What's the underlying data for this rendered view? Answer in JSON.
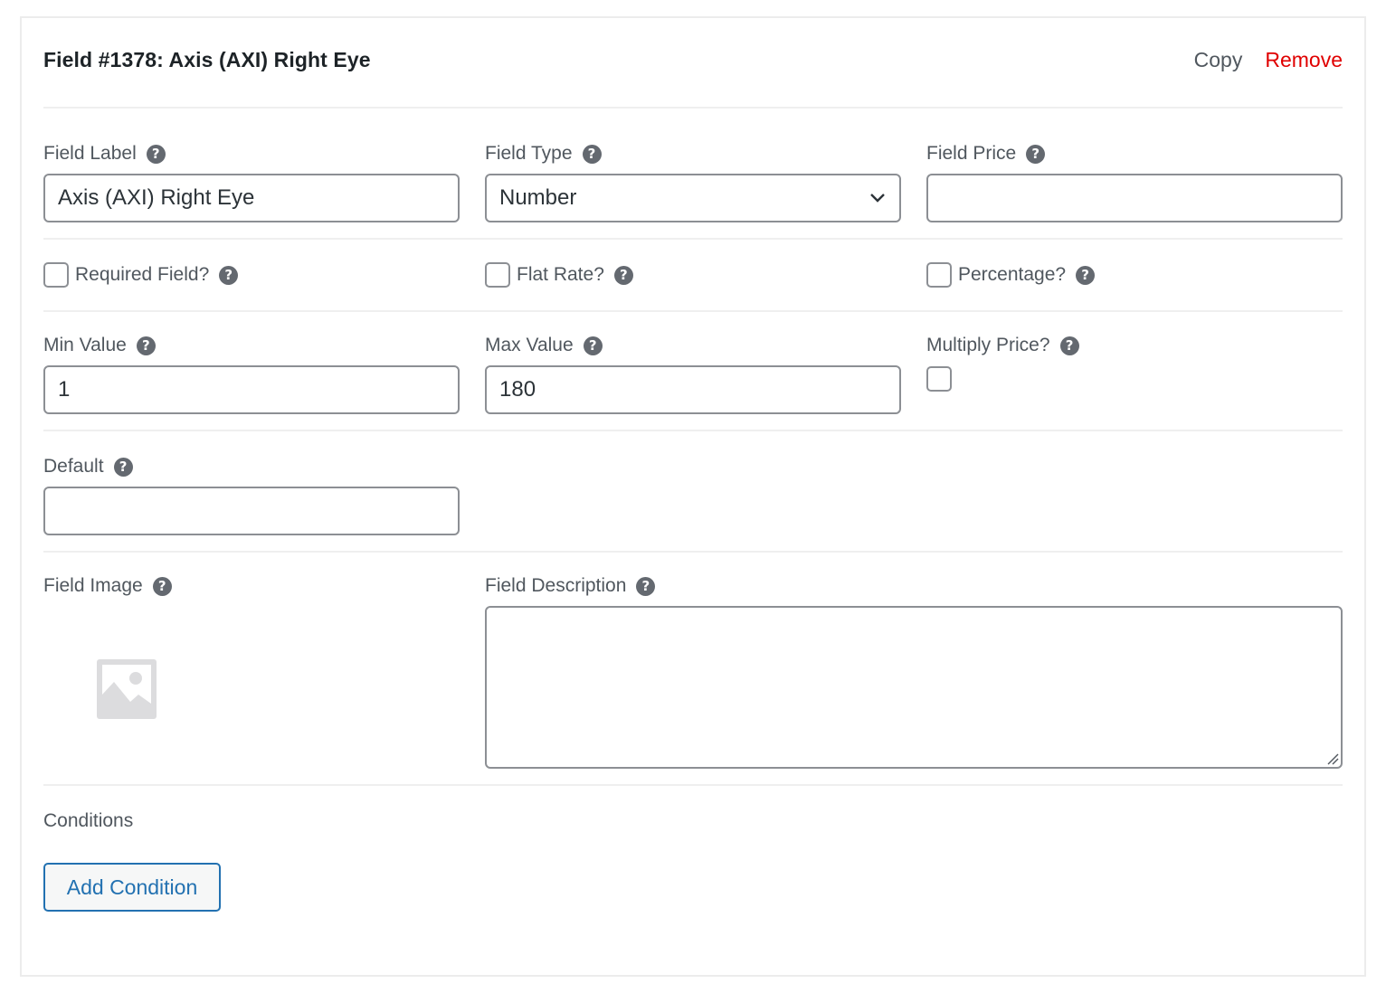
{
  "header": {
    "title": "Field #1378: Axis (AXI) Right Eye",
    "copy_label": "Copy",
    "remove_label": "Remove"
  },
  "colors": {
    "remove": "#e00000",
    "accent": "#2271b1",
    "help_icon": "#646970"
  },
  "fields": {
    "field_label": {
      "label": "Field Label",
      "value": "Axis (AXI) Right Eye",
      "help_icon": "question-circle-icon"
    },
    "field_type": {
      "label": "Field Type",
      "value": "Number",
      "help_icon": "question-circle-icon"
    },
    "field_price": {
      "label": "Field Price",
      "value": "",
      "help_icon": "question-circle-icon"
    },
    "required_field": {
      "label": "Required Field?",
      "checked": false
    },
    "flat_rate": {
      "label": "Flat Rate?",
      "checked": false
    },
    "percentage": {
      "label": "Percentage?",
      "checked": false
    },
    "min_value": {
      "label": "Min Value",
      "value": "1"
    },
    "max_value": {
      "label": "Max Value",
      "value": "180"
    },
    "multiply_price": {
      "label": "Multiply Price?",
      "checked": false
    },
    "default": {
      "label": "Default",
      "value": ""
    },
    "field_image": {
      "label": "Field Image",
      "icon": "image-placeholder-icon"
    },
    "field_description": {
      "label": "Field Description",
      "value": ""
    }
  },
  "conditions": {
    "heading": "Conditions",
    "add_button_label": "Add Condition"
  },
  "help_glyph": "?"
}
